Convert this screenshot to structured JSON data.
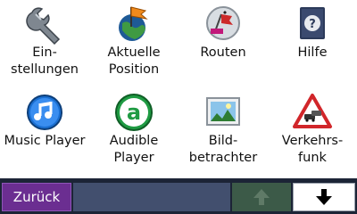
{
  "menu": {
    "items": [
      {
        "label": "Ein-\nstellungen",
        "icon": "wrench-icon"
      },
      {
        "label": "Aktuelle\nPosition",
        "icon": "globe-flag-icon"
      },
      {
        "label": "Routen",
        "icon": "routes-flags-icon"
      },
      {
        "label": "Hilfe",
        "icon": "help-book-icon"
      },
      {
        "label": "Music Player",
        "icon": "music-note-icon"
      },
      {
        "label": "Audible\nPlayer",
        "icon": "audible-icon"
      },
      {
        "label": "Bild-\nbetrachter",
        "icon": "picture-viewer-icon"
      },
      {
        "label": "Verkehrs-\nfunk",
        "icon": "traffic-warning-icon"
      }
    ]
  },
  "footer": {
    "back_label": "Zurück",
    "scroll_up_icon": "arrow-up-icon",
    "scroll_down_icon": "arrow-down-icon"
  },
  "colors": {
    "back_button": "#6b2e91",
    "bar_background": "#1c2436",
    "up_button_disabled": "#3c5a48",
    "down_button": "#ffffff"
  }
}
